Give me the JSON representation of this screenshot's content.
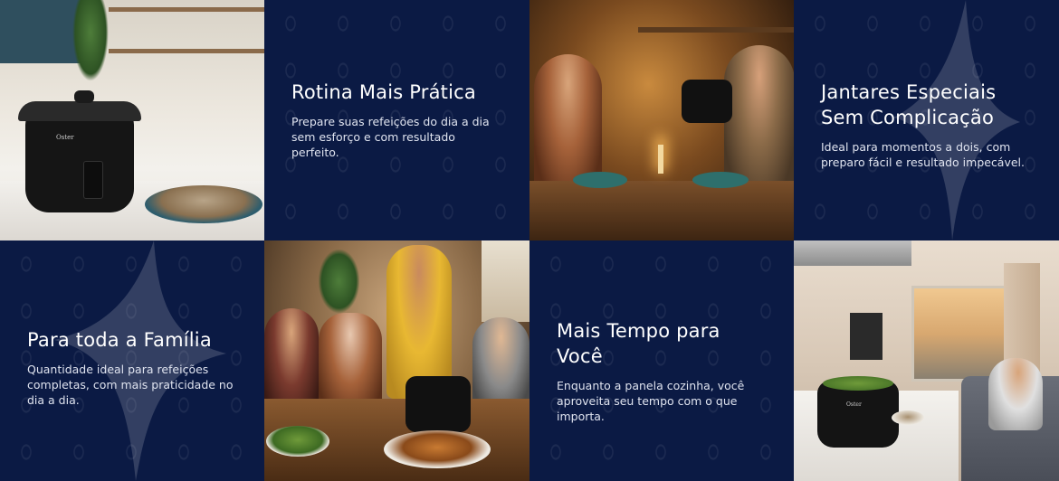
{
  "tiles": [
    {
      "title": "Rotina Mais Prática",
      "description": "Prepare suas refeições do dia a dia sem esforço e com resultado perfeito."
    },
    {
      "title": "Jantares Especiais Sem Complicação",
      "description": "Ideal para momentos a dois, com preparo fácil e resultado impecável."
    },
    {
      "title": "Para toda a Família",
      "description": "Quantidade ideal para refeições completas, com mais praticidade no dia a dia."
    },
    {
      "title": "Mais Tempo para Você",
      "description": "Enquanto a panela cozinha, você aproveita seu tempo com o que importa."
    }
  ],
  "photos": {
    "kitchen": {
      "brand_label": "Oster"
    },
    "living": {
      "brand_label": "Oster"
    }
  },
  "colors": {
    "background": "#0b1a44",
    "text": "#ffffff",
    "description_text": "#dfe3ef"
  }
}
